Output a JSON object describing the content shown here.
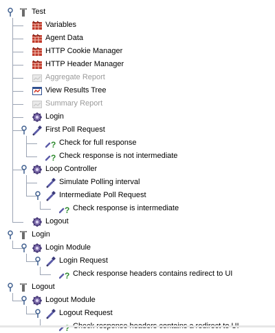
{
  "tree": {
    "nodes": [
      {
        "label": "Test",
        "icon": "test-plan-icon",
        "level": 0
      },
      {
        "label": "Variables",
        "icon": "config-element-icon",
        "level": 1
      },
      {
        "label": "Agent Data",
        "icon": "config-element-icon",
        "level": 1
      },
      {
        "label": "HTTP Cookie Manager",
        "icon": "config-element-icon",
        "level": 1
      },
      {
        "label": "HTTP Header Manager",
        "icon": "config-element-icon",
        "level": 1
      },
      {
        "label": "Aggregate Report",
        "icon": "listener-disabled-icon",
        "level": 1,
        "disabled": true
      },
      {
        "label": "View Results Tree",
        "icon": "results-tree-icon",
        "level": 1
      },
      {
        "label": "Summary Report",
        "icon": "listener-disabled-icon",
        "level": 1,
        "disabled": true
      },
      {
        "label": "Login",
        "icon": "module-controller-icon",
        "level": 1
      },
      {
        "label": "First Poll Request",
        "icon": "sampler-pipette-icon",
        "level": 1
      },
      {
        "label": "Check for full response",
        "icon": "assertion-icon",
        "level": 2
      },
      {
        "label": "Check response is not intermediate",
        "icon": "assertion-icon",
        "level": 2
      },
      {
        "label": "Loop Controller",
        "icon": "loop-controller-icon",
        "level": 1
      },
      {
        "label": "Simulate Polling interval",
        "icon": "sampler-pipette-icon",
        "level": 2
      },
      {
        "label": "Intermediate Poll Request",
        "icon": "sampler-pipette-icon",
        "level": 2
      },
      {
        "label": "Check response is intermediate",
        "icon": "assertion-icon",
        "level": 3
      },
      {
        "label": "Logout",
        "icon": "module-controller-icon",
        "level": 1
      },
      {
        "label": "Login",
        "icon": "test-fragment-icon",
        "level": 0
      },
      {
        "label": "Login Module",
        "icon": "module-controller-icon",
        "level": 1
      },
      {
        "label": "Login Request",
        "icon": "sampler-pipette-icon",
        "level": 2
      },
      {
        "label": "Check response headers contains redirect to UI",
        "icon": "assertion-icon",
        "level": 3
      },
      {
        "label": "Logout",
        "icon": "test-fragment-icon",
        "level": 0
      },
      {
        "label": "Logout Module",
        "icon": "module-controller-icon",
        "level": 1
      },
      {
        "label": "Logout Request",
        "icon": "sampler-pipette-icon",
        "level": 2
      },
      {
        "label": "Check response headers contains a redirect to UI",
        "icon": "assertion-icon",
        "level": 3
      }
    ]
  },
  "colors": {
    "line": "#9aa3b3",
    "disabled_text": "#9a9a9a",
    "assertion_green": "#2c8a2c",
    "config_red": "#c0392b",
    "pipette_purple": "#5b5ba8"
  }
}
